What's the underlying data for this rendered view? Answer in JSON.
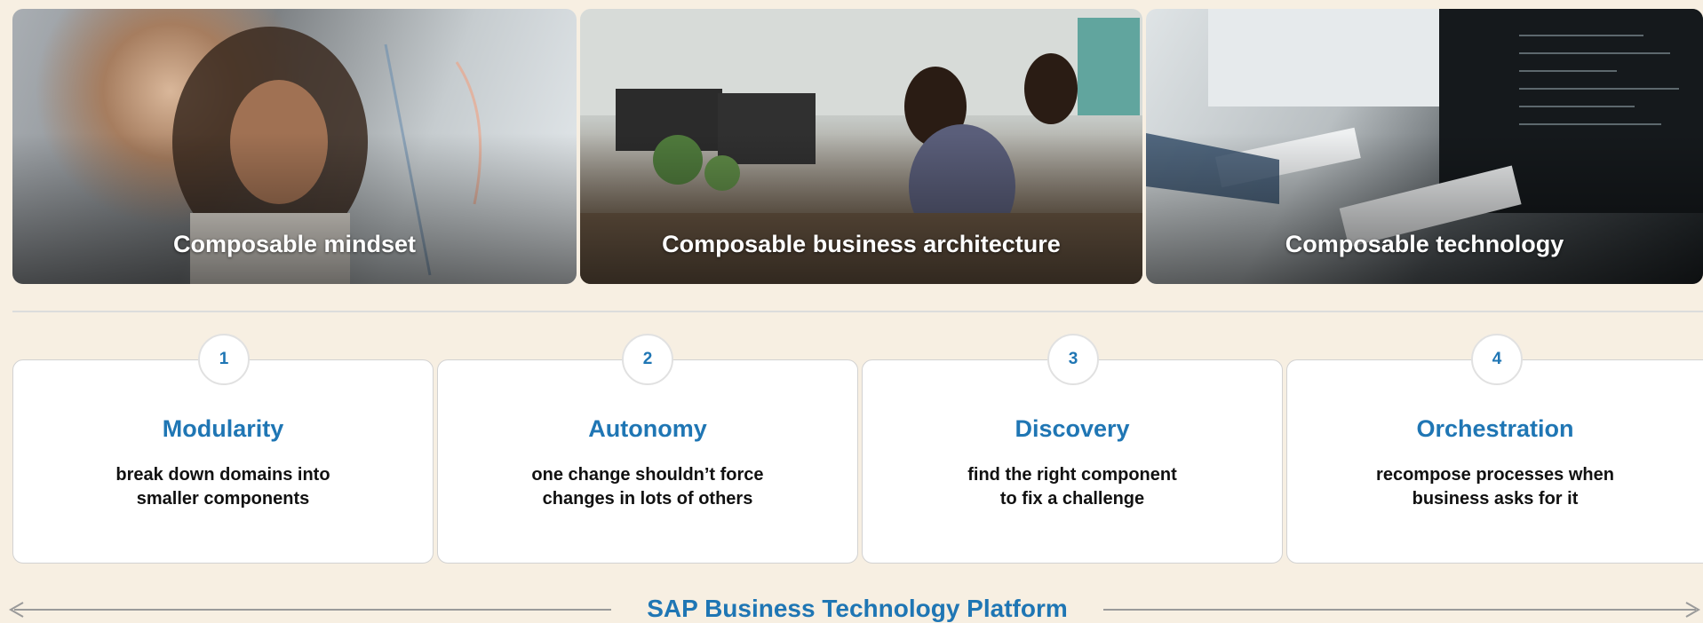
{
  "pillars": [
    {
      "caption": "Composable mindset"
    },
    {
      "caption": "Composable business architecture"
    },
    {
      "caption": "Composable technology"
    }
  ],
  "principles": [
    {
      "number": "1",
      "title": "Modularity",
      "desc_line1": "break down domains into",
      "desc_line2": "smaller components"
    },
    {
      "number": "2",
      "title": "Autonomy",
      "desc_line1": "one change shouldn’t force",
      "desc_line2": "changes in lots of others"
    },
    {
      "number": "3",
      "title": "Discovery",
      "desc_line1": "find the right component",
      "desc_line2": "to fix a challenge"
    },
    {
      "number": "4",
      "title": "Orchestration",
      "desc_line1": "recompose processes when",
      "desc_line2": "business asks for it"
    }
  ],
  "platform_label": "SAP Business Technology Platform",
  "colors": {
    "accent": "#1f76b4",
    "background": "#f7efe2",
    "text": "#111111"
  }
}
